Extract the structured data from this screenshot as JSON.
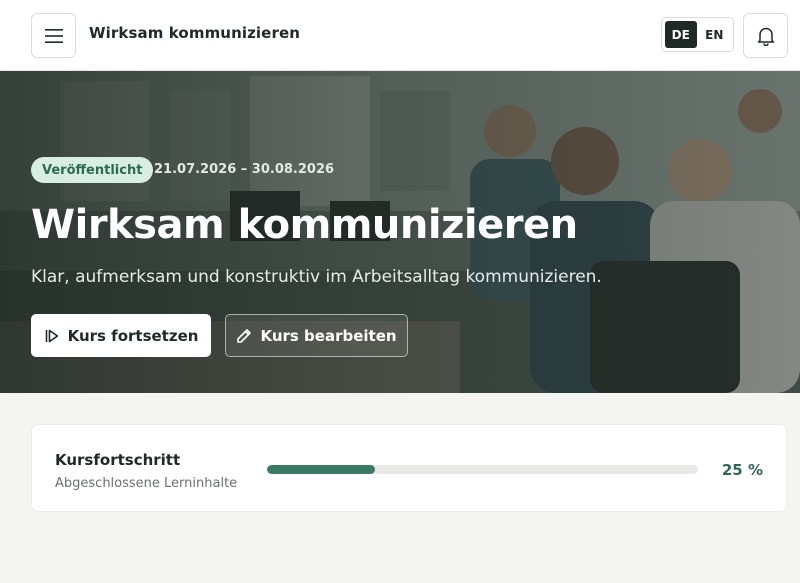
{
  "header": {
    "title": "Wirksam kommunizieren",
    "languages": [
      {
        "code": "DE",
        "active": true
      },
      {
        "code": "EN",
        "active": false
      }
    ],
    "menu_icon": "hamburger-icon",
    "notification_icon": "bell-icon"
  },
  "hero": {
    "status": "Veröffentlicht",
    "date_range": "21.07.2026 – 30.08.2026",
    "title": "Wirksam kommunizieren",
    "subtitle": "Klar, aufmerksam und konstruktiv im Arbeitsalltag kommunizieren.",
    "continue_label": "Kurs fortsetzen",
    "continue_icon": "play-icon",
    "edit_label": "Kurs bearbeiten",
    "edit_icon": "pencil-icon"
  },
  "progress": {
    "title": "Kursfortschritt",
    "subtitle": "Abgeschlossene Lerninhalte",
    "percent": 25,
    "value_label": "25 %"
  },
  "colors": {
    "accent": "#3a7a62",
    "badge_bg": "#d8eee3",
    "dark": "#1f2a26"
  }
}
